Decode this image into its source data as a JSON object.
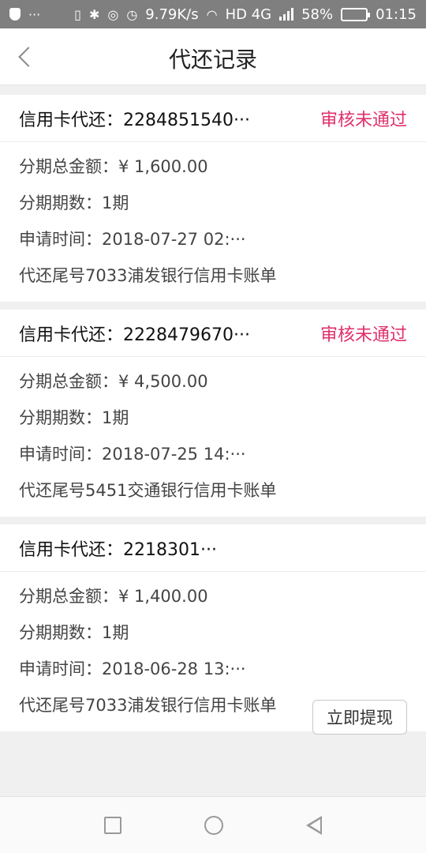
{
  "status_bar": {
    "dots": "···",
    "speed": "9.79K/s",
    "network": "HD 4G",
    "battery": "58%",
    "battery_level": 0.58,
    "time": "01:15"
  },
  "header": {
    "title": "代还记录"
  },
  "records": [
    {
      "title": "信用卡代还：2284851540···",
      "status": "审核未通过",
      "amount": "分期总金额：¥ 1,600.00",
      "periods": "分期期数：1期",
      "time": "申请时间：2018-07-27 02:···",
      "desc": "代还尾号7033浦发银行信用卡账单"
    },
    {
      "title": "信用卡代还：2228479670···",
      "status": "审核未通过",
      "amount": "分期总金额：¥ 4,500.00",
      "periods": "分期期数：1期",
      "time": "申请时间：2018-07-25 14:···",
      "desc": "代还尾号5451交通银行信用卡账单"
    },
    {
      "title": "信用卡代还：2218301···",
      "status": "",
      "amount": "分期总金额：¥ 1,400.00",
      "periods": "分期期数：1期",
      "time": "申请时间：2018-06-28 13:···",
      "desc": "代还尾号7033浦发银行信用卡账单",
      "button": "立即提现"
    }
  ],
  "icons": {
    "back": "chevron-left-icon",
    "nav_recent": "square-icon",
    "nav_home": "circle-icon",
    "nav_back": "triangle-back-icon"
  },
  "colors": {
    "status_text": "#e0306a",
    "status_bar": "#7f7f7f"
  }
}
